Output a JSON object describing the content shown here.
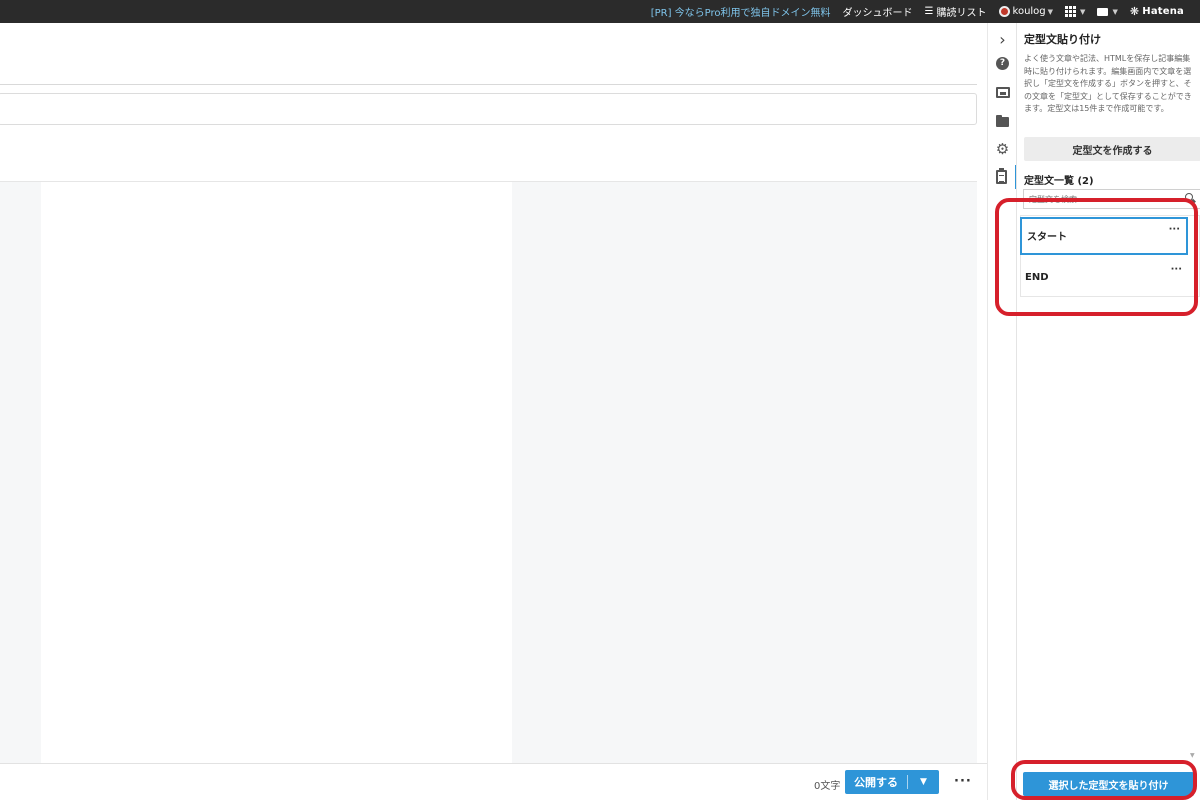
{
  "topbar": {
    "promo": "[PR] 今ならPro利用で独自ドメイン無料",
    "dashboard": "ダッシュボード",
    "reading_list": "購読リスト",
    "user": "koulog",
    "brand": "Hatena"
  },
  "editor": {
    "char_count": "0文字",
    "publish_label": "公開する",
    "publish_dropdown_icon": "chevron-down-icon",
    "more_label": "···"
  },
  "sidebar_icons": [
    "chevron-right-icon",
    "help-icon",
    "image-icon",
    "folder-icon",
    "gear-icon",
    "clipboard-icon"
  ],
  "panel": {
    "title": "定型文貼り付け",
    "description": "よく使う文章や記法、HTMLを保存し記事編集時に貼り付けられます。編集画面内で文章を選択し「定型文を作成する」ボタンを押すと、その文章を「定型文」として保存することができます。定型文は15件まで作成可能です。",
    "create_button": "定型文を作成する",
    "list_title": "定型文一覧 (2)",
    "search_placeholder": "定型文を検索",
    "items": [
      {
        "label": "スタート",
        "menu": "···"
      },
      {
        "label": "END",
        "menu": "···"
      }
    ],
    "paste_button": "選択した定型文を貼り付け"
  },
  "colors": {
    "accent": "#2e95d8",
    "annotation": "#d6202b",
    "topbar": "#2b2b2b"
  }
}
